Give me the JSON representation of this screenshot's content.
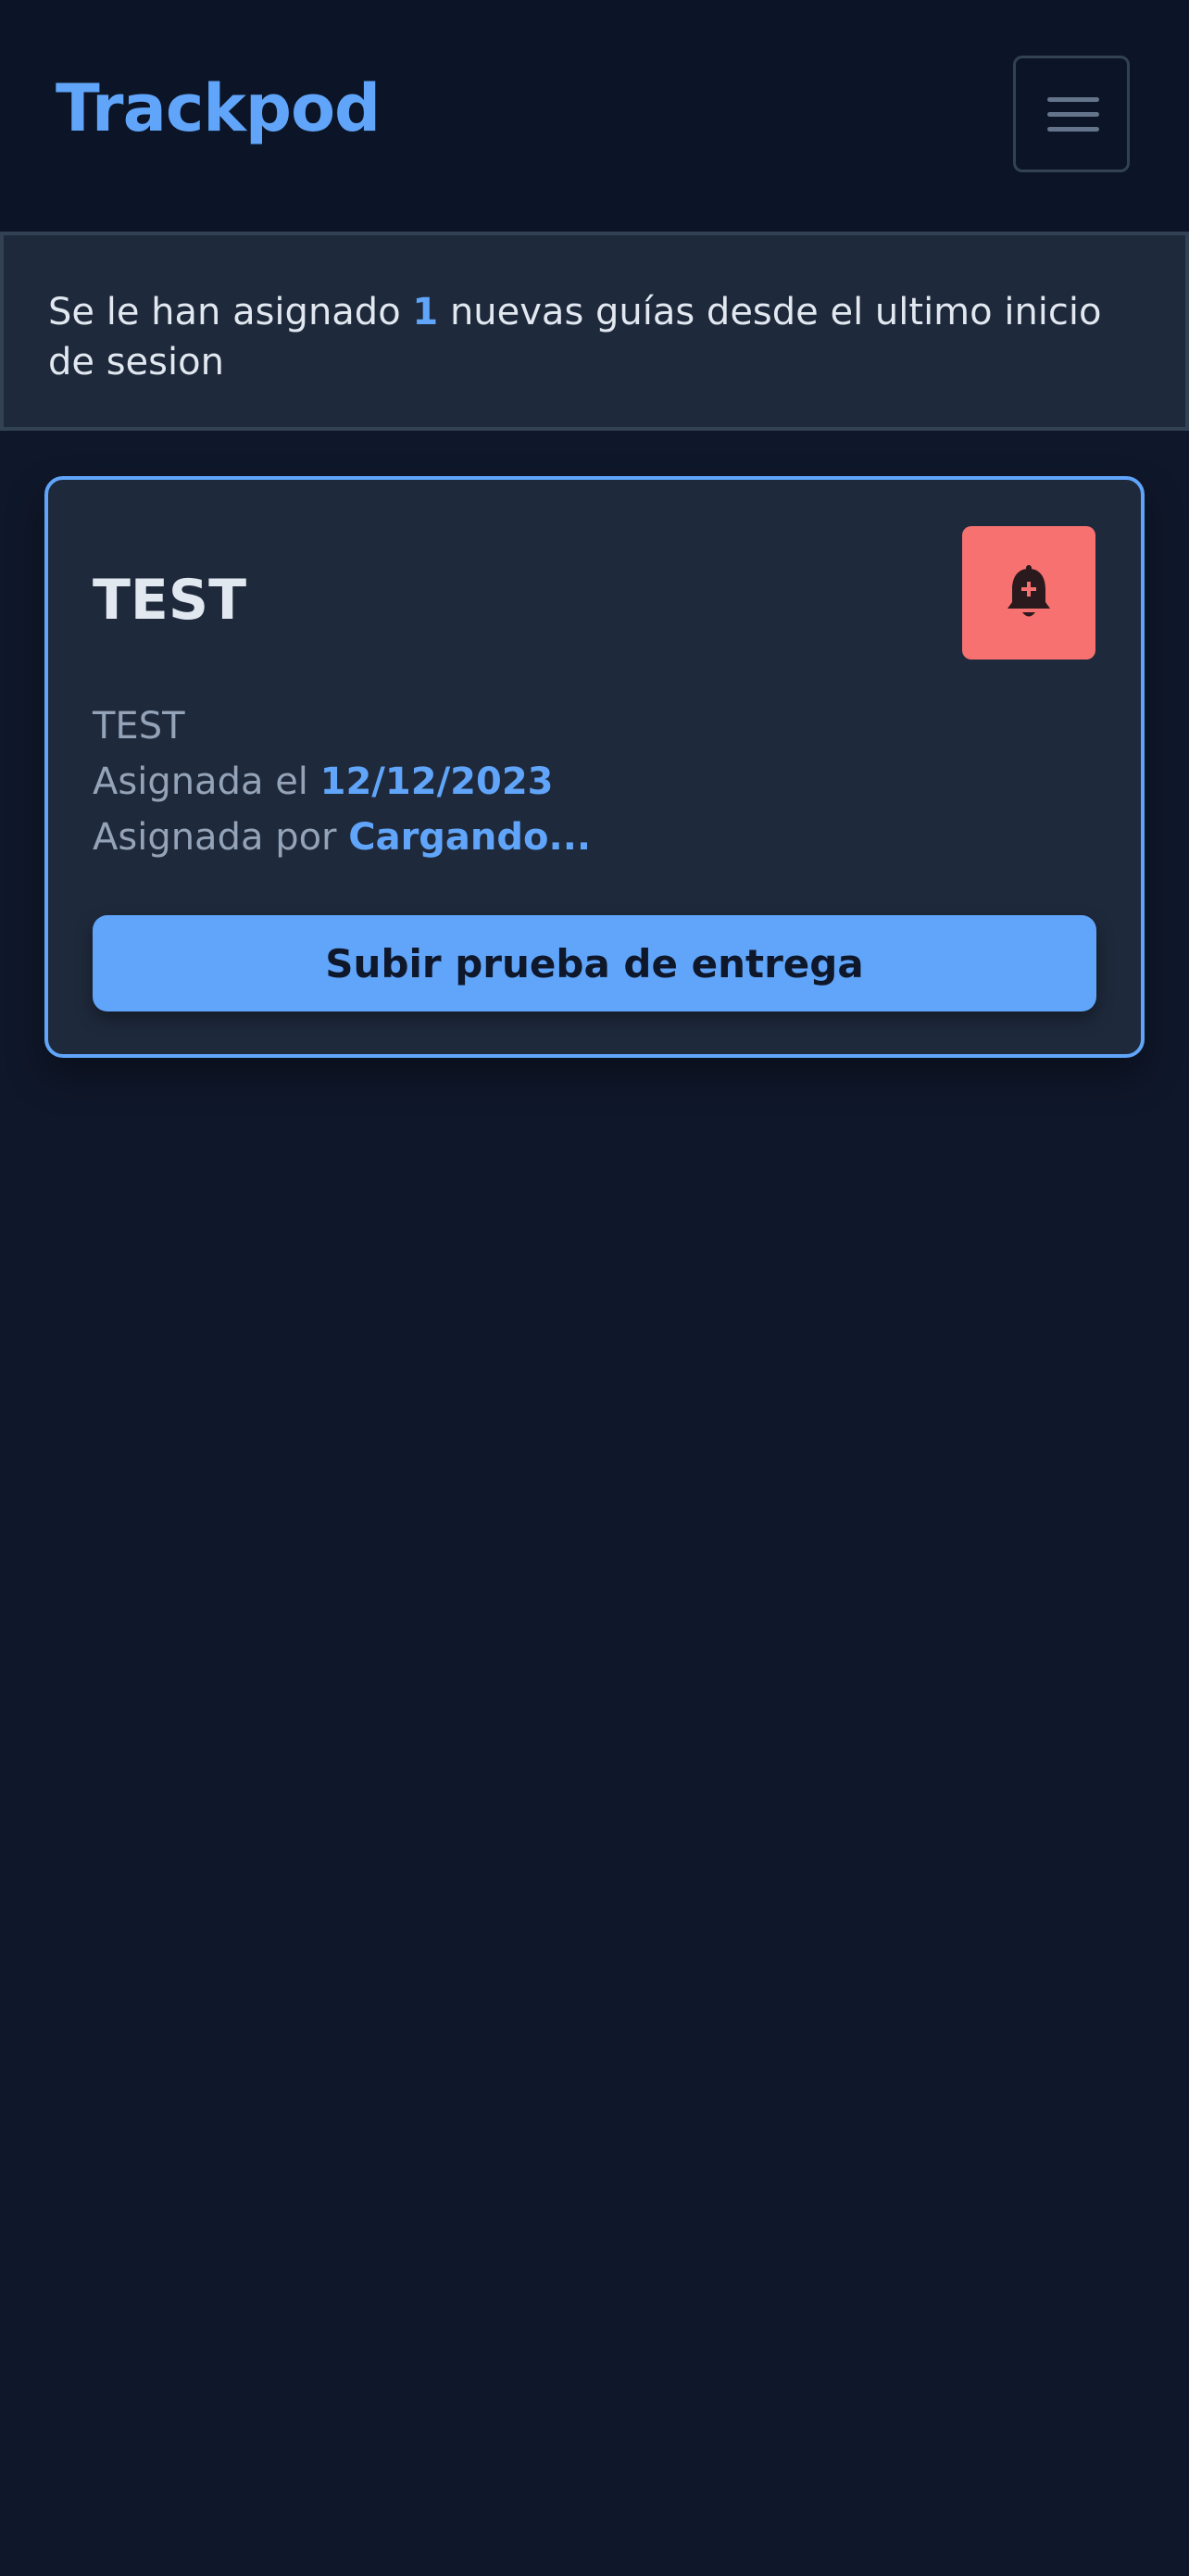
{
  "navbar": {
    "brand": "Trackpod",
    "menu_icon": "hamburger-menu-icon"
  },
  "alert": {
    "prefix": "Se le han asignado ",
    "count": "1",
    "suffix": " nuevas guías desde el ultimo inicio de sesion"
  },
  "guide_card": {
    "title": "TEST",
    "description": "TEST",
    "assigned_on_label": "Asignada el ",
    "assigned_on_value": "12/12/2023",
    "assigned_by_label": "Asignada por ",
    "assigned_by_value": "Cargando...",
    "bell_icon": "bell-plus-icon",
    "upload_button_label": "Subir prueba de entrega"
  },
  "colors": {
    "background": "#0f172a",
    "navbar": "#0c1527",
    "panel": "#1e293b",
    "accent": "#60a5fa",
    "alert_button": "#f87171",
    "muted_text": "#94a3b8",
    "text": "#e2e8f0"
  }
}
